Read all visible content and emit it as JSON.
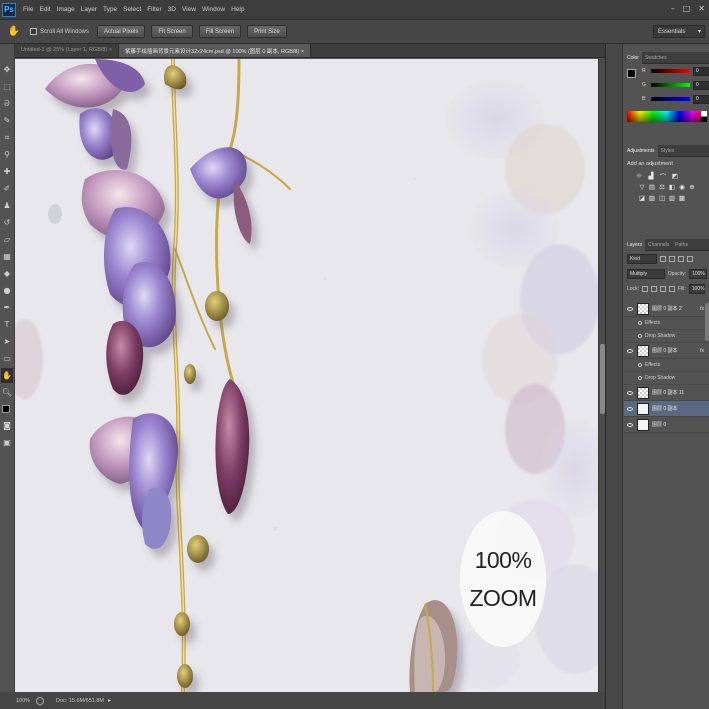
{
  "app": {
    "logo": "Ps"
  },
  "menu": [
    "File",
    "Edit",
    "Image",
    "Layer",
    "Type",
    "Select",
    "Filter",
    "3D",
    "View",
    "Window",
    "Help"
  ],
  "window_controls": [
    "–",
    "□",
    "✕"
  ],
  "options_bar": {
    "scroll_all_label": "Scroll All Windows",
    "buttons": [
      "Actual Pixels",
      "Fit Screen",
      "Fill Screen",
      "Print Size"
    ],
    "workspace": "Essentials"
  },
  "doc_tabs": [
    {
      "label": "Untitled-1 @ 25% (Layer 1, RGB/8) ×",
      "active": false
    },
    {
      "label": "紫藤手绘插画背景元素设计32x24cm.psd @ 100% (图层 0 副本, RGB/8) ×",
      "active": true
    }
  ],
  "canvas": {
    "zoom_badge_line1": "100%",
    "zoom_badge_line2": "ZOOM"
  },
  "status": {
    "zoom": "100%",
    "doc": "Doc: 15.6M/651.8M"
  },
  "color_panel": {
    "tabs": [
      "Color",
      "Swatches"
    ],
    "rows": [
      {
        "label": "R",
        "value": "0"
      },
      {
        "label": "G",
        "value": "0"
      },
      {
        "label": "B",
        "value": "0"
      }
    ]
  },
  "adjustments_panel": {
    "tabs": [
      "Adjustments",
      "Styles"
    ],
    "title": "Add an adjustment",
    "icons_row1": [
      "brightness-icon",
      "levels-icon",
      "curves-icon",
      "exposure-icon"
    ],
    "icons_row2": [
      "vibrance-icon",
      "hue-saturation-icon",
      "color-balance-icon",
      "black-white-icon",
      "photo-filter-icon",
      "channel-mixer-icon"
    ],
    "icons_row3": [
      "invert-icon",
      "posterize-icon",
      "threshold-icon",
      "gradient-map-icon",
      "selective-color-icon"
    ]
  },
  "layers_panel": {
    "tabs": [
      "Layers",
      "Channels",
      "Paths"
    ],
    "kind": "Kind",
    "blend_mode": "Multiply",
    "opacity_label": "Opacity:",
    "opacity": "100%",
    "lock_label": "Lock:",
    "fill_label": "Fill:",
    "fill": "100%",
    "layers": [
      {
        "name": "图层 0 副本 2",
        "fx": true,
        "selected": false,
        "solid": false,
        "effects": [
          "Effects",
          "Drop Shadow"
        ]
      },
      {
        "name": "图层 0 副本",
        "fx": true,
        "selected": false,
        "solid": false,
        "effects": [
          "Effects",
          "Drop Shadow"
        ]
      },
      {
        "name": "图层 0 副本 11",
        "fx": false,
        "selected": false,
        "solid": false,
        "effects": []
      },
      {
        "name": "图层 0 副本",
        "fx": false,
        "selected": true,
        "solid": true,
        "effects": []
      },
      {
        "name": "图层 0",
        "fx": false,
        "selected": false,
        "solid": true,
        "effects": []
      }
    ]
  },
  "colors": {
    "ui_dark": "#535353",
    "selection": "#596a80",
    "canvas_paper": "#e9e9ed",
    "wisteria_purple": "#8a6fb8",
    "wisteria_violet": "#6b3a5c",
    "stem_gold": "#c9a84a"
  }
}
